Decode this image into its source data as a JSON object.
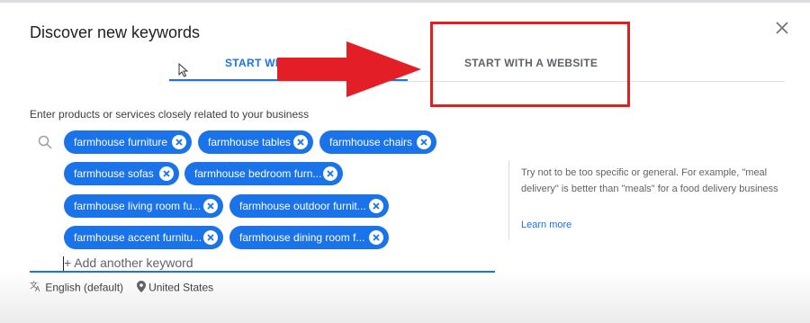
{
  "dialog": {
    "title": "Discover new keywords"
  },
  "tabs": [
    {
      "label": "START WIT",
      "active": true
    },
    {
      "label": "START WITH A WEBSITE",
      "active": false
    }
  ],
  "prompt": "Enter products or services closely related to your business",
  "chips": [
    "farmhouse furniture",
    "farmhouse tables",
    "farmhouse chairs",
    "farmhouse sofas",
    "farmhouse bedroom furn...",
    "farmhouse living room fu...",
    "farmhouse outdoor furnit...",
    "farmhouse accent furnitu...",
    "farmhouse dining room f..."
  ],
  "input": {
    "placeholder": "+ Add another keyword",
    "value": ""
  },
  "settings": {
    "language": "English (default)",
    "location": "United States"
  },
  "help": {
    "text": "Try not to be too specific or general. For example, \"meal delivery\" is better than \"meals\" for a food delivery business",
    "link": "Learn more"
  },
  "colors": {
    "accent": "#1a73e8",
    "annotation_red": "#e02020"
  },
  "icons": [
    "close-icon",
    "search-icon",
    "translate-icon",
    "location-pin-icon",
    "chip-remove-icon",
    "cursor-icon",
    "red-arrow-annotation"
  ]
}
